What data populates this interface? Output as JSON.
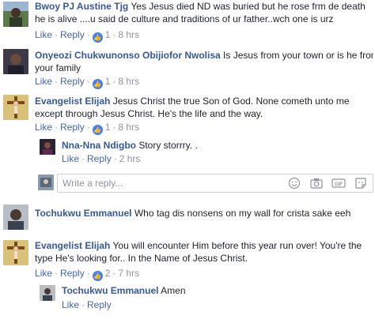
{
  "actions": {
    "like": "Like",
    "reply": "Reply",
    "separator": "·"
  },
  "comments": [
    {
      "author": "Bwoy PJ Austine Tjg",
      "line1": "Yes Jesus died ND was buried but he rose frm de death",
      "line2": "he is alive ....u said de culture and traditions of ur father..wch one is urz",
      "likes": "1",
      "time": "8 hrs"
    },
    {
      "author": "Onyeozi Chukwunonso Obijiofor Nwolisa",
      "line1": "Is Jesus from your town or is he from",
      "line2": "your family",
      "likes": "1",
      "time": "8 hrs"
    },
    {
      "author": "Evangelist Elijah",
      "line1": "Jesus Christ the true Son of God. None cometh unto me",
      "line2": "except through Jesus Christ. He's the life and the way.",
      "likes": "1",
      "time": "8 hrs",
      "reply": {
        "author": "Nna-Nna Ndigbo",
        "text": "Story storrry. .",
        "time": "2 hrs"
      }
    },
    {
      "author": "Tochukwu Emmanuel",
      "line1": "Who tag dis nonsens on my wall for crista sake eeh"
    },
    {
      "author": "Evangelist Elijah",
      "line1": "You will encounter Him before this year run over! You're the",
      "line2": "type He's looking for.. In the Name of Jesus Christ.",
      "likes": "2",
      "time": "7 hrs",
      "reply": {
        "author": "Tochukwu Emmanuel",
        "text": "Amen"
      }
    }
  ],
  "reply_box": {
    "placeholder": "Write a reply..."
  },
  "colors": {
    "link": "#365899",
    "action": "#4267b2",
    "meta": "#90949c",
    "like_badge": "#4080ff"
  }
}
